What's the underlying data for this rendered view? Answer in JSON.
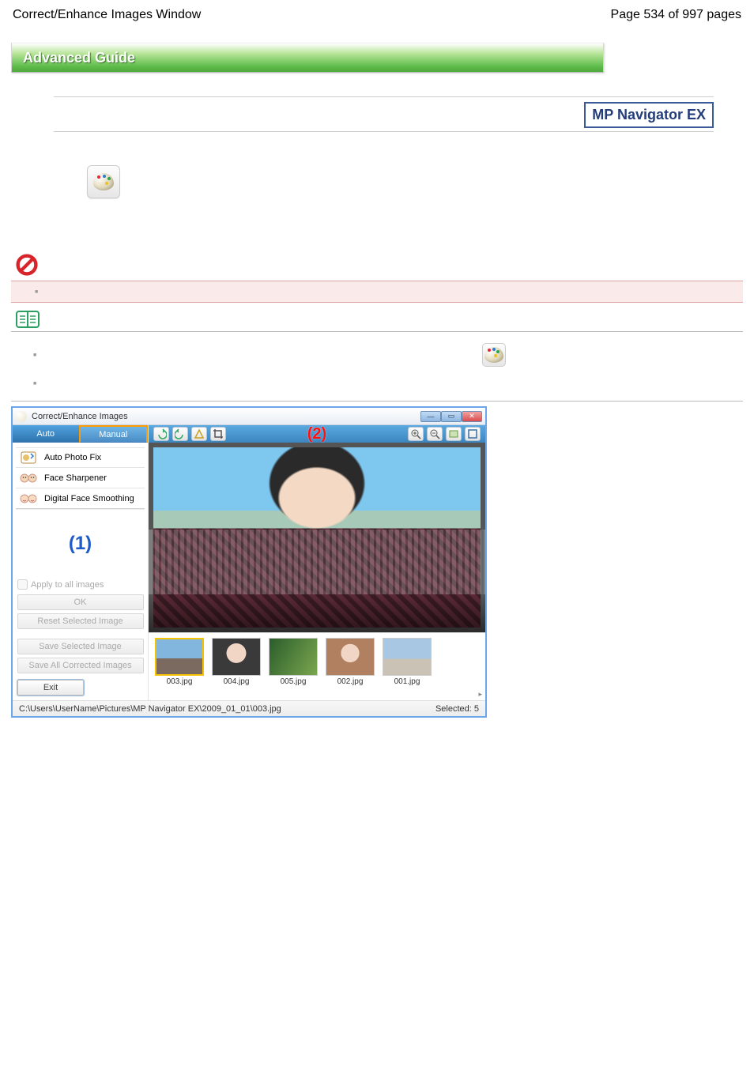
{
  "page": {
    "title_left": "Correct/Enhance Images Window",
    "title_right": "Page 534 of 997 pages",
    "guide_header": "Advanced Guide",
    "mp_navigator": "MP Navigator EX"
  },
  "bullets": {
    "b1": "■",
    "b2": "■",
    "b3": "■"
  },
  "dialog": {
    "title": "Correct/Enhance Images",
    "tabs": {
      "auto": "Auto",
      "manual": "Manual"
    },
    "tools": {
      "autophotofix": "Auto Photo Fix",
      "facesharpener": "Face Sharpener",
      "digitalfacesmoothing": "Digital Face Smoothing"
    },
    "callout1": "(1)",
    "callout2": "(2)",
    "apply_all": "Apply to all images",
    "btn_ok": "OK",
    "btn_reset": "Reset Selected Image",
    "btn_save_sel": "Save Selected Image",
    "btn_save_all": "Save All Corrected Images",
    "btn_exit": "Exit",
    "thumbs": [
      {
        "label": "003.jpg"
      },
      {
        "label": "004.jpg"
      },
      {
        "label": "005.jpg"
      },
      {
        "label": "002.jpg"
      },
      {
        "label": "001.jpg"
      }
    ],
    "status_path": "C:\\Users\\UserName\\Pictures\\MP Navigator EX\\2009_01_01\\003.jpg",
    "status_selected": "Selected: 5"
  }
}
